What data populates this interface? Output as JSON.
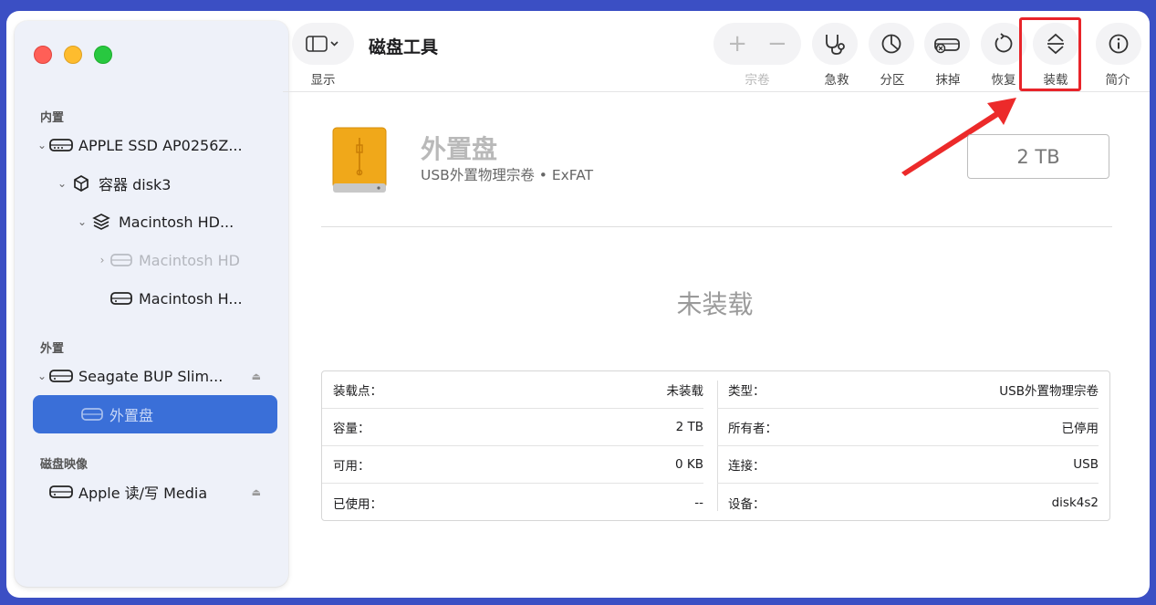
{
  "toolbar": {
    "title": "磁盘工具",
    "view_label": "显示",
    "volume_label": "宗卷",
    "first_aid_label": "急救",
    "partition_label": "分区",
    "erase_label": "抹掉",
    "restore_label": "恢复",
    "mount_label": "装载",
    "info_label": "简介",
    "add_glyph": "+",
    "remove_glyph": "−"
  },
  "sidebar": {
    "internal_label": "内置",
    "external_label": "外置",
    "images_label": "磁盘映像",
    "items": [
      {
        "label": "APPLE SSD AP0256Z...",
        "icon": "internal-drive-icon"
      },
      {
        "label": "容器 disk3",
        "icon": "container-icon"
      },
      {
        "label": "Macintosh HD...",
        "icon": "volume-stack-icon"
      },
      {
        "label": "Macintosh HD",
        "icon": "drive-icon"
      },
      {
        "label": "Macintosh H...",
        "icon": "drive-icon"
      },
      {
        "label": "Seagate BUP Slim...",
        "icon": "external-drive-icon"
      },
      {
        "label": "外置盘",
        "icon": "drive-icon"
      },
      {
        "label": "Apple 读/写 Media",
        "icon": "drive-icon"
      }
    ]
  },
  "detail": {
    "name": "外置盘",
    "subtitle": "USB外置物理宗卷 • ExFAT",
    "size": "2 TB",
    "status": "未装载",
    "left_rows": [
      {
        "key": "装载点：",
        "value": "未装载"
      },
      {
        "key": "容量：",
        "value": "2 TB"
      },
      {
        "key": "可用：",
        "value": "0 KB"
      },
      {
        "key": "已使用：",
        "value": "--"
      }
    ],
    "right_rows": [
      {
        "key": "类型：",
        "value": "USB外置物理宗卷"
      },
      {
        "key": "所有者：",
        "value": "已停用"
      },
      {
        "key": "连接：",
        "value": "USB"
      },
      {
        "key": "设备：",
        "value": "disk4s2"
      }
    ]
  },
  "colors": {
    "accent": "#3a6fd8",
    "highlight": "#e8242a",
    "drive_orange": "#f0a81a"
  }
}
